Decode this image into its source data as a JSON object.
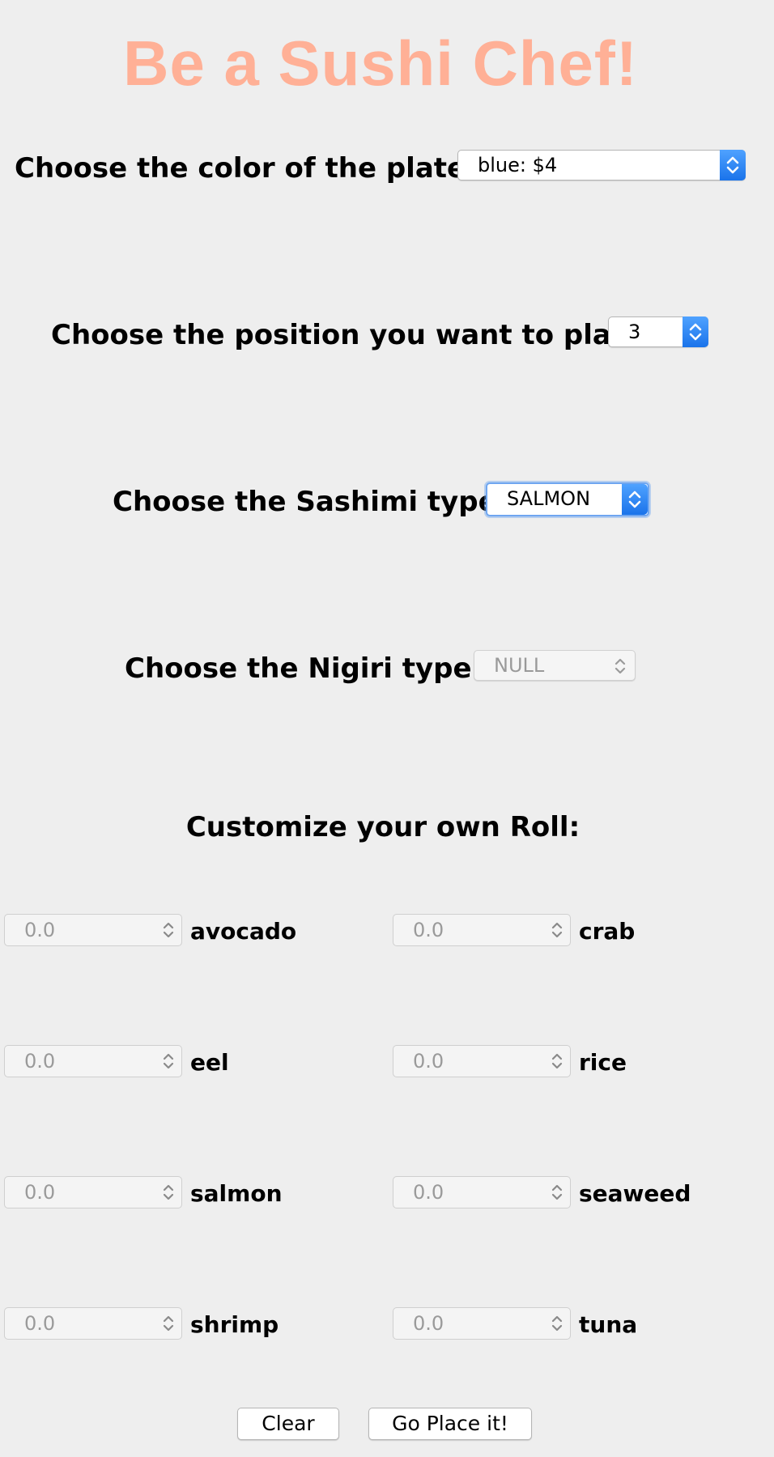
{
  "title": "Be a Sushi Chef!",
  "colors": {
    "title": "#ffb096",
    "accent": "#1a73ea",
    "background": "#eeeeee"
  },
  "plate": {
    "label": "Choose the color of the plate:",
    "value": "blue: $4"
  },
  "position": {
    "label": "Choose the position you want to place:",
    "value": "3"
  },
  "sashimi": {
    "label": "Choose the Sashimi type:",
    "value": "SALMON"
  },
  "nigiri": {
    "label": "Choose the Nigiri type:",
    "value": "NULL"
  },
  "roll": {
    "heading": "Customize your own Roll:",
    "ingredients": [
      {
        "name": "avocado",
        "value": "0.0"
      },
      {
        "name": "crab",
        "value": "0.0"
      },
      {
        "name": "eel",
        "value": "0.0"
      },
      {
        "name": "rice",
        "value": "0.0"
      },
      {
        "name": "salmon",
        "value": "0.0"
      },
      {
        "name": "seaweed",
        "value": "0.0"
      },
      {
        "name": "shrimp",
        "value": "0.0"
      },
      {
        "name": "tuna",
        "value": "0.0"
      }
    ]
  },
  "buttons": {
    "clear": "Clear",
    "place": "Go Place it!"
  },
  "icons": {
    "dropdown": "chevron-up-down-icon",
    "stepper": "stepper-arrows-icon"
  }
}
